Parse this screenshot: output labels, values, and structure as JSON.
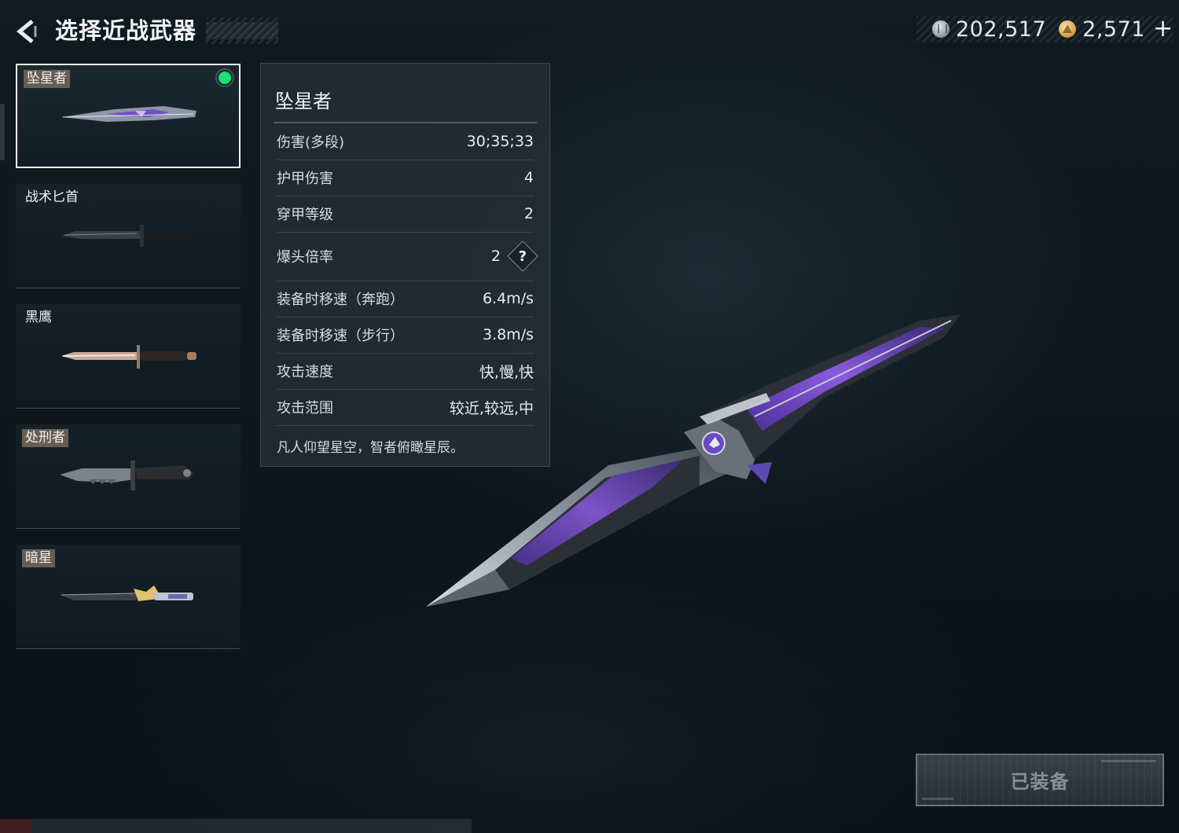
{
  "header": {
    "title": "选择近战武器",
    "back_icon": "back-arrow-icon"
  },
  "currency": {
    "silver": {
      "icon": "silver-coin-icon",
      "value": "202,517"
    },
    "gold": {
      "icon": "gold-coin-icon",
      "value": "2,571"
    },
    "add_label": "+"
  },
  "weapons": [
    {
      "name": "坠星者",
      "selected": true,
      "equipped": true,
      "tagged": true
    },
    {
      "name": "战术匕首",
      "selected": false,
      "equipped": false,
      "tagged": false
    },
    {
      "name": "黑鹰",
      "selected": false,
      "equipped": false,
      "tagged": false
    },
    {
      "name": "处刑者",
      "selected": false,
      "equipped": false,
      "tagged": true
    },
    {
      "name": "暗星",
      "selected": false,
      "equipped": false,
      "tagged": true
    }
  ],
  "stats": {
    "title": "坠星者",
    "rows": [
      {
        "label": "伤害(多段)",
        "value": "30;35;33"
      },
      {
        "label": "护甲伤害",
        "value": "4"
      },
      {
        "label": "穿甲等级",
        "value": "2"
      },
      {
        "label": "爆头倍率",
        "value": "2",
        "help": "?"
      },
      {
        "label": "装备时移速（奔跑）",
        "value": "6.4m/s"
      },
      {
        "label": "装备时移速（步行）",
        "value": "3.8m/s"
      },
      {
        "label": "攻击速度",
        "value": "快,慢,快"
      },
      {
        "label": "攻击范围",
        "value": "较近,较远,中"
      }
    ],
    "description": "凡人仰望星空，智者俯瞰星辰。"
  },
  "equip_button": {
    "label": "已装备"
  },
  "colors": {
    "equipped_dot": "#19e07a",
    "knife_purple": "#7a4fd6",
    "panel_bg": "#222c34"
  }
}
